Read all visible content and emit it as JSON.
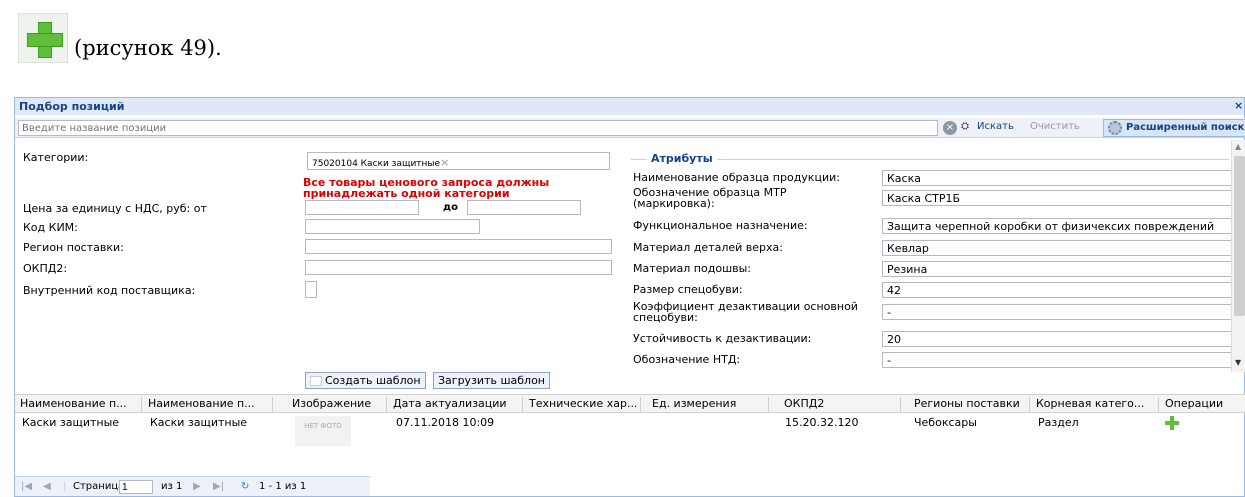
{
  "doc": {
    "caption": "(рисунок 49)."
  },
  "window": {
    "title": "Подбор позиций",
    "close": "×"
  },
  "search": {
    "placeholder": "Введите название позиции",
    "clear_icon": "×",
    "search_label": "Искать",
    "clear_label": "Очистить",
    "advanced_label": "Расширенный поиск"
  },
  "filters": {
    "categories_label": "Категории:",
    "category_tag": "75020104 Каски защитные",
    "category_tag_remove": "×",
    "warning": "Все товары ценового запроса должны принадлежать одной категории",
    "price_label": "Цена за единицу с НДС, руб: от",
    "price_to_label": "до",
    "price_from": "",
    "price_to": "",
    "kim_label": "Код КИМ:",
    "kim": "",
    "region_label": "Регион поставки:",
    "region": "",
    "okpd2_label": "ОКПД2:",
    "okpd2": "",
    "supplier_code_label": "Внутренний код поставщика:"
  },
  "attributes": {
    "legend": "Атрибуты",
    "rows": [
      {
        "label": "Наименование образца продукции:",
        "value": "Каска"
      },
      {
        "label": "Обозначение образца МТР (маркировка):",
        "value": "Каска СТР1Б"
      },
      {
        "label": "Функциональное назначение:",
        "value": "Защита черепной коробки от физичексих повреждений"
      },
      {
        "label": "Материал деталей верха:",
        "value": "Кевлар"
      },
      {
        "label": "Материал подошвы:",
        "value": "Резина"
      },
      {
        "label": "Размер спецобуви:",
        "value": "42"
      },
      {
        "label": "Коэффициент дезактивации основной спецобуви:",
        "value": "-"
      },
      {
        "label": "Устойчивость к дезактивации:",
        "value": "20"
      },
      {
        "label": "Обозначение НТД:",
        "value": "-"
      }
    ]
  },
  "buttons": {
    "create_template": "Создать шаблон",
    "load_template": "Загрузить шаблон"
  },
  "grid": {
    "columns": [
      "Наименование п...",
      "Наименование п...",
      "Изображение",
      "Дата актуализации",
      "Технические хар...",
      "Ед. измерения",
      "ОКПД2",
      "Регионы поставки",
      "Корневая катего...",
      "Операции"
    ],
    "rows": [
      {
        "name1": "Каски защитные",
        "name2": "Каски защитные",
        "image_text": "НЕТ ФОТО",
        "date": "07.11.2018 10:09",
        "tech": "",
        "unit": "",
        "okpd2": "15.20.32.120",
        "regions": "Чебоксары",
        "root_category": "Раздел"
      }
    ]
  },
  "pager": {
    "page_label": "Страница",
    "page": "1",
    "of_label": "из 1",
    "summary": "1 - 1 из 1"
  },
  "colors": {
    "accent": "#15428b",
    "warning": "#e00000",
    "add": "#5fbf3a"
  }
}
